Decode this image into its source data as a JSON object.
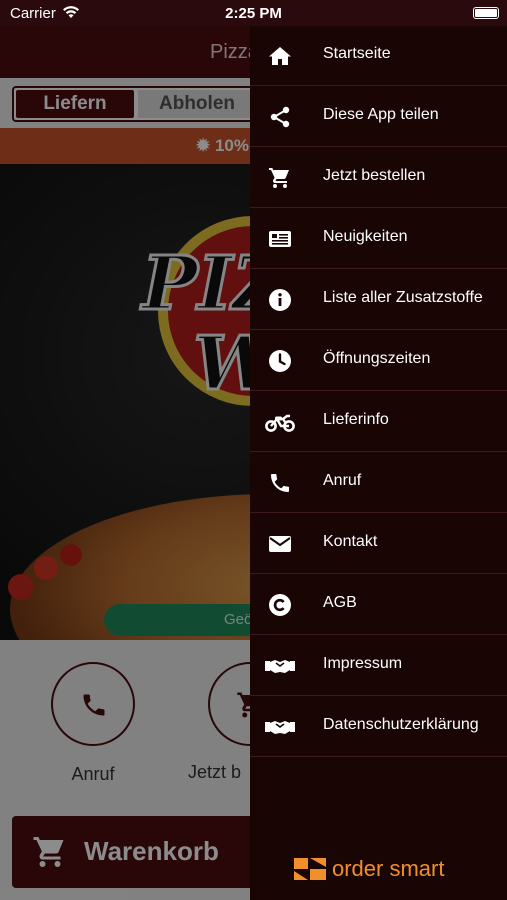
{
  "status_bar": {
    "carrier": "Carrier",
    "time": "2:25 PM"
  },
  "app": {
    "header_title": "Pizza",
    "mode_tabs": [
      {
        "label": "Liefern"
      },
      {
        "label": "Abholen"
      }
    ],
    "promo_text": "10%",
    "hero_button_text": "Geö",
    "quick_actions": [
      {
        "label": "Anruf"
      },
      {
        "label": "Jetzt b"
      }
    ],
    "cart_label": "Warenkorb"
  },
  "drawer": {
    "items": [
      {
        "label": "Startseite",
        "icon": "home-icon"
      },
      {
        "label": "Diese App teilen",
        "icon": "share-icon"
      },
      {
        "label": "Jetzt bestellen",
        "icon": "cart-icon"
      },
      {
        "label": "Neuigkeiten",
        "icon": "news-icon"
      },
      {
        "label": "Liste aller Zusatzstoffe",
        "icon": "info-icon"
      },
      {
        "label": "Öffnungszeiten",
        "icon": "clock-icon"
      },
      {
        "label": "Lieferinfo",
        "icon": "motorcycle-icon"
      },
      {
        "label": "Anruf",
        "icon": "phone-icon"
      },
      {
        "label": "Kontakt",
        "icon": "mail-icon"
      },
      {
        "label": "AGB",
        "icon": "copyright-icon"
      },
      {
        "label": "Impressum",
        "icon": "handshake-icon"
      },
      {
        "label": "Datenschutzerklärung",
        "icon": "handshake-icon"
      }
    ],
    "brand_text": "order smart"
  },
  "colors": {
    "accent": "#4b0e12",
    "drawer_bg": "#1a0505",
    "brand": "#f08f2b",
    "promo": "#c8522a"
  }
}
